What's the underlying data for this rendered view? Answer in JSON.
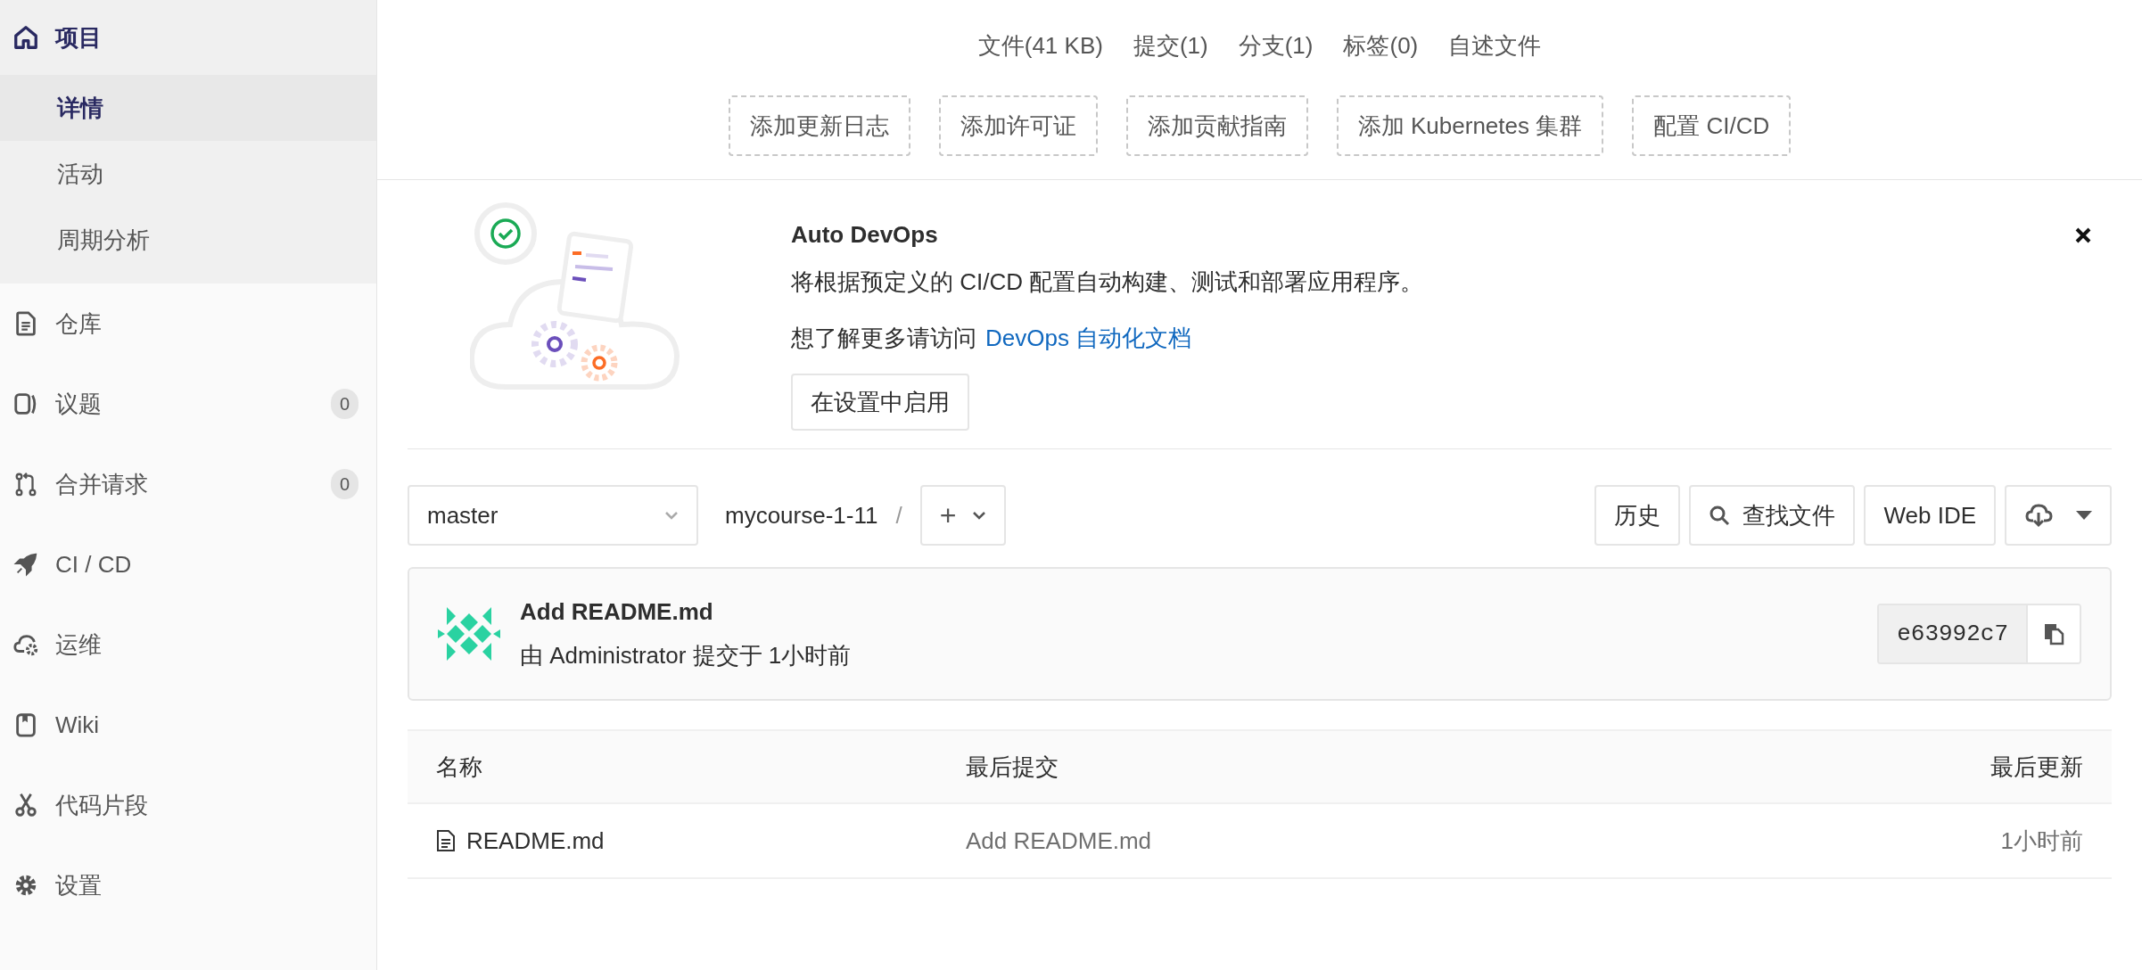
{
  "sidebar": {
    "items": [
      {
        "label": "项目",
        "selected": true,
        "children": [
          {
            "label": "详情",
            "selected": true
          },
          {
            "label": "活动",
            "selected": false
          },
          {
            "label": "周期分析",
            "selected": false
          }
        ]
      },
      {
        "label": "仓库",
        "selected": false
      },
      {
        "label": "议题",
        "selected": false,
        "count": "0"
      },
      {
        "label": "合并请求",
        "selected": false,
        "count": "0"
      },
      {
        "label": "CI / CD",
        "selected": false
      },
      {
        "label": "运维",
        "selected": false
      },
      {
        "label": "Wiki",
        "selected": false
      },
      {
        "label": "代码片段",
        "selected": false
      },
      {
        "label": "设置",
        "selected": false
      }
    ]
  },
  "stats": [
    "文件(41 KB)",
    "提交(1)",
    "分支(1)",
    "标签(0)",
    "自述文件"
  ],
  "add_buttons": [
    "添加更新日志",
    "添加许可证",
    "添加贡献指南",
    "添加 Kubernetes 集群",
    "配置 CI/CD"
  ],
  "auto_devops": {
    "title": "Auto DevOps",
    "description": "将根据预定义的 CI/CD 配置自动构建、测试和部署应用程序。",
    "learn_more": "想了解更多请访问",
    "link": "DevOps 自动化文档",
    "button": "在设置中启用"
  },
  "repo_bar": {
    "branch": "master",
    "path": "mycourse-1-11",
    "separator": "/",
    "add": "+",
    "history": "历史",
    "find_file": "查找文件",
    "web_ide": "Web IDE"
  },
  "last_commit": {
    "title": "Add README.md",
    "meta": "由 Administrator 提交于 1小时前",
    "sha": "e63992c7"
  },
  "table": {
    "columns": [
      "名称",
      "最后提交",
      "最后更新"
    ],
    "rows": [
      {
        "name": "README.md",
        "commit": "Add README.md",
        "updated": "1小时前"
      }
    ]
  }
}
